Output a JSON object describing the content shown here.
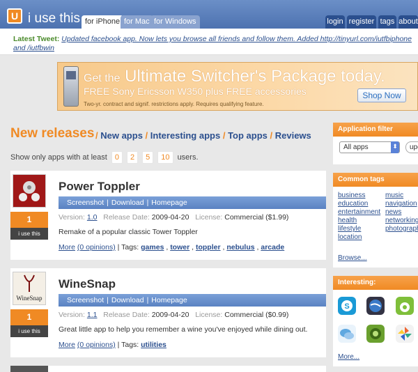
{
  "header": {
    "logo_letter": "U",
    "site_name": "i use this",
    "tabs": [
      "for iPhone",
      "for Mac",
      "for Windows"
    ],
    "right_tabs": [
      "login",
      "register",
      "tags",
      "about"
    ]
  },
  "tweet": {
    "label": "Latest Tweet:",
    "text": "Updated facebook app. Now lets you browse all friends and follow them. Added http://tinyurl.com/iutfbiphone and /iutfbwin"
  },
  "banner": {
    "line1_small": "Get the",
    "line1_big": "Ultimate Switcher's Package today.",
    "line2": "FREE Sony Ericsson W350 plus FREE accessories",
    "line3": "Two-yr. contract and signif. restrictions apply. Requires qualifying feature.",
    "button": "Shop Now"
  },
  "main": {
    "title": "New releases",
    "links": [
      "New apps",
      "Interesting apps",
      "Top apps",
      "Reviews"
    ],
    "filter": {
      "prefix": "Show only apps with at least",
      "options": [
        "0",
        "2",
        "5",
        "10"
      ],
      "suffix": "users."
    },
    "apps": [
      {
        "name": "Power Toppler",
        "count": "1",
        "iuse": "i use this",
        "links": [
          "Screenshot",
          "Download",
          "Homepage"
        ],
        "version_label": "Version:",
        "version": "1.0",
        "date_label": "Release Date:",
        "date": "2009-04-20",
        "license_label": "License:",
        "license": "Commercial ($1.99)",
        "desc": "Remake of a popular classic Tower Toppler",
        "more": "More",
        "opinions": "(0 opinions)",
        "tags_label": "| Tags:",
        "tags": [
          "games",
          "tower",
          "toppler",
          "nebulus",
          "arcade"
        ]
      },
      {
        "name": "WineSnap",
        "count": "1",
        "iuse": "i use this",
        "thumb_text": "WineSnap",
        "links": [
          "Screenshot",
          "Download",
          "Homepage"
        ],
        "version_label": "Version:",
        "version": "1.1",
        "date_label": "Release Date:",
        "date": "2009-04-20",
        "license_label": "License:",
        "license": "Commercial ($0.99)",
        "desc": "Great little app to help you remember a wine you've enjoyed while dining out.",
        "more": "More",
        "opinions": "(0 opinions)",
        "tags_label": "| Tags:",
        "tags": [
          "utilities"
        ]
      }
    ]
  },
  "sidebar": {
    "filter_title": "Application filter",
    "filter_select": "All apps",
    "filter_button": "upd",
    "tags_title": "Common tags",
    "tags_col1": [
      "business",
      "education",
      "entertainment",
      "health",
      "lifestyle",
      "location"
    ],
    "tags_col2": [
      "music",
      "navigation",
      "news",
      "networking",
      "photography"
    ],
    "browse": "Browse...",
    "interesting_title": "Interesting:",
    "more": "More..."
  },
  "colors": {
    "accent": "#f08a24",
    "link": "#2b4f8e",
    "header": "#4d72b0"
  }
}
